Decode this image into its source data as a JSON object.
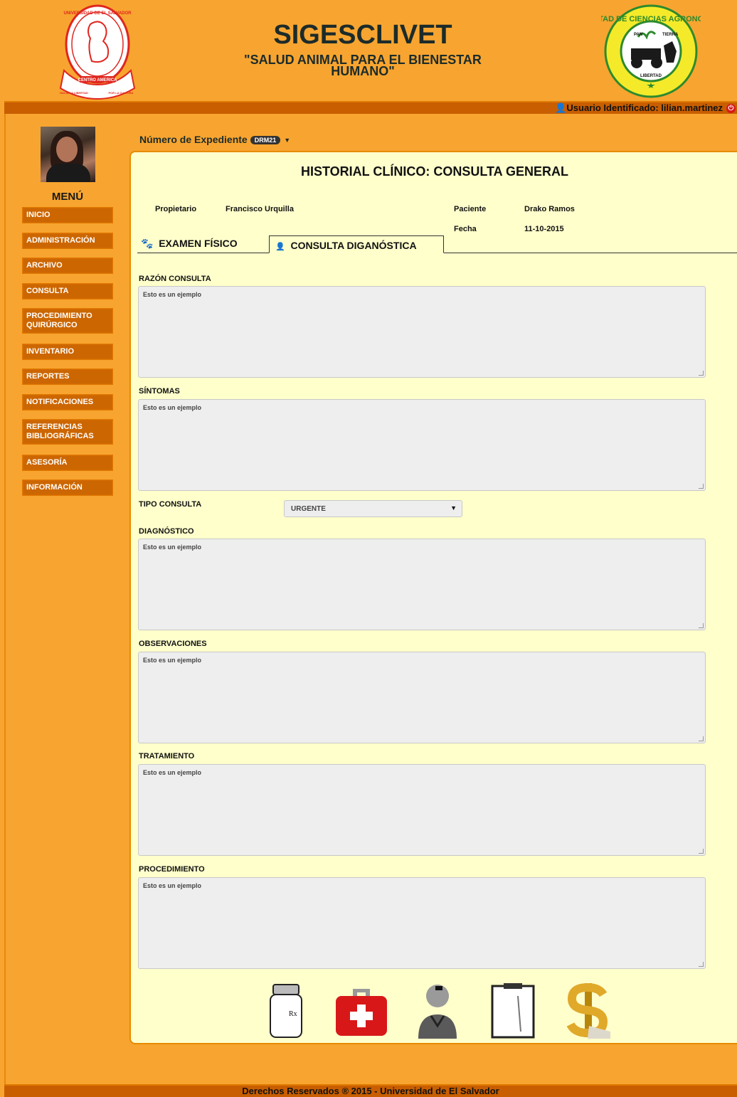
{
  "header": {
    "title": "SIGESCLIVET",
    "subtitle": "\"SALUD ANIMAL PARA EL BIENESTAR HUMANO\"",
    "logo_left_text": [
      "UNIVERSIDAD DE EL SALVADOR",
      "CENTRO AMERICA",
      "HACIA LA LIBERTAD",
      "POR LA CULTURA"
    ],
    "logo_right_text": [
      "FACULTAD DE CIENCIAS AGRONOMICAS",
      "PAN",
      "TIERRA",
      "LIBERTAD"
    ]
  },
  "userbar": {
    "label": "Usuario Identificado: lilian.martinez",
    "icon": "user-icon",
    "logout_icon": "power-icon"
  },
  "sidebar": {
    "menu_title": "MENÚ",
    "items": [
      {
        "label": "INICIO"
      },
      {
        "label": "ADMINISTRACIÓN"
      },
      {
        "label": "ARCHIVO"
      },
      {
        "label": "CONSULTA"
      },
      {
        "label": "PROCEDIMIENTO QUIRÚRGICO"
      },
      {
        "label": "INVENTARIO"
      },
      {
        "label": "REPORTES"
      },
      {
        "label": "NOTIFICACIONES"
      },
      {
        "label": "REFERENCIAS BIBLIOGRÁFICAS"
      },
      {
        "label": "ASESORÍA"
      },
      {
        "label": "INFORMACIÓN"
      }
    ]
  },
  "expediente": {
    "label": "Número de Expediente",
    "badge": "DRM21"
  },
  "main": {
    "title": "HISTORIAL CLÍNICO: CONSULTA GENERAL",
    "propietario_label": "Propietario",
    "propietario_value": "Francisco Urquilla",
    "paciente_label": "Paciente",
    "paciente_value": "Drako Ramos",
    "fecha_label": "Fecha",
    "fecha_value": "11-10-2015",
    "tabs": [
      {
        "label": "EXAMEN FÍSICO",
        "icon": "paw-icon",
        "active": false
      },
      {
        "label": "CONSULTA DIGANÓSTICA",
        "icon": "user-add-icon",
        "active": true
      }
    ],
    "fields": {
      "razon": {
        "label": "RAZÓN CONSULTA",
        "value": "Esto es un ejemplo"
      },
      "sintomas": {
        "label": "SÍNTOMAS",
        "value": "Esto es un ejemplo"
      },
      "tipo": {
        "label": "TIPO CONSULTA",
        "value": "URGENTE"
      },
      "diagnostico": {
        "label": "DIAGNÓSTICO",
        "value": "Esto es un ejemplo"
      },
      "observaciones": {
        "label": "OBSERVACIONES",
        "value": "Esto es un ejemplo"
      },
      "tratamiento": {
        "label": "TRATAMIENTO",
        "value": "Esto es un ejemplo"
      },
      "procedimiento": {
        "label": "PROCEDIMIENTO",
        "value": "Esto es un ejemplo"
      }
    },
    "action_icons": [
      "prescription-bottle-icon",
      "first-aid-kit-icon",
      "doctor-icon",
      "clipboard-icon",
      "dollar-icon"
    ],
    "rx_text": "Rx"
  },
  "footer": {
    "text": "Derechos Reservados ® 2015 - Universidad de El Salvador"
  },
  "colors": {
    "background": "#f7a530",
    "bar": "#c85e00",
    "menu_item": "#cc6600",
    "content_bg": "#ffffcc",
    "field_bg": "#eeeeee"
  }
}
